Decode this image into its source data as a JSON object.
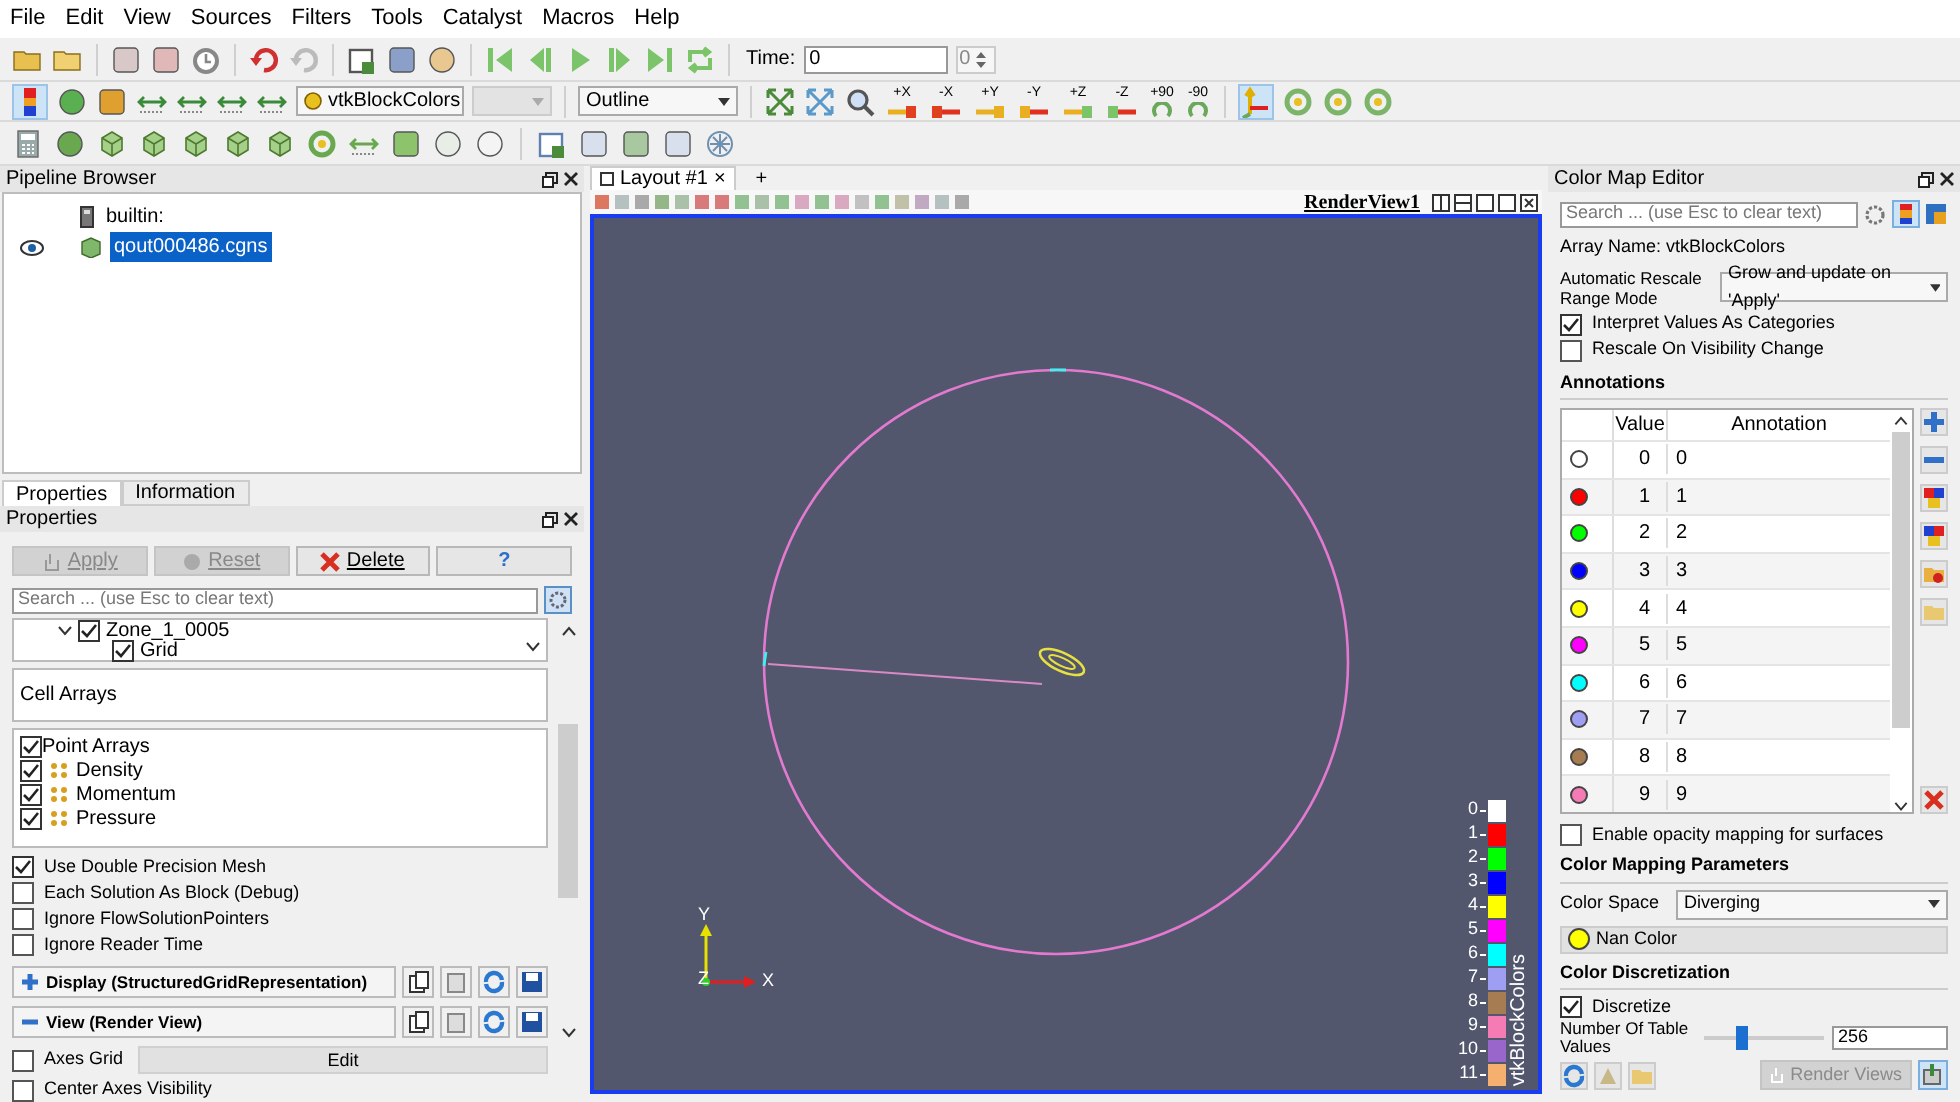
{
  "menu": [
    "File",
    "Edit",
    "View",
    "Sources",
    "Filters",
    "Tools",
    "Catalyst",
    "Macros",
    "Help"
  ],
  "time": {
    "label": "Time:",
    "value": "0",
    "step": "0"
  },
  "representation_toolbar": {
    "array": "vtkBlockColors",
    "representation": "Outline"
  },
  "camera_buttons": [
    {
      "label": "+X"
    },
    {
      "label": "-X"
    },
    {
      "label": "+Y"
    },
    {
      "label": "-Y"
    },
    {
      "label": "+Z"
    },
    {
      "label": "-Z"
    },
    {
      "label": "+90"
    },
    {
      "label": "-90"
    }
  ],
  "pipeline_browser": {
    "title": "Pipeline Browser",
    "items": [
      {
        "label": "builtin:",
        "selected": false,
        "visible": false
      },
      {
        "label": "qout000486.cgns",
        "selected": true,
        "visible": true
      }
    ]
  },
  "panel_tabs": [
    {
      "label": "Properties",
      "selected": true
    },
    {
      "label": "Information",
      "selected": false
    }
  ],
  "properties": {
    "title": "Properties",
    "buttons": [
      {
        "label": "Apply",
        "kind": "apply",
        "disabled": true
      },
      {
        "label": "Reset",
        "kind": "reset",
        "disabled": true
      },
      {
        "label": "Delete",
        "kind": "delete",
        "disabled": false
      },
      {
        "label": "?",
        "kind": "help",
        "disabled": false
      }
    ],
    "search_placeholder": "Search ... (use Esc to clear text)",
    "tree": [
      {
        "label": "Zone_1_0005",
        "checked": true,
        "expanded": true,
        "children": [
          {
            "label": "Grid",
            "checked": true
          }
        ]
      }
    ],
    "cell_arrays": {
      "title": "Cell Arrays"
    },
    "point_arrays": {
      "title": "Point Arrays",
      "checked": true,
      "items": [
        {
          "label": "Density",
          "checked": true
        },
        {
          "label": "Momentum",
          "checked": true
        },
        {
          "label": "Pressure",
          "checked": true
        }
      ]
    },
    "options": [
      {
        "label": "Use Double Precision Mesh",
        "checked": true
      },
      {
        "label": "Each Solution As Block (Debug)",
        "checked": false
      },
      {
        "label": "Ignore FlowSolutionPointers",
        "checked": false
      },
      {
        "label": "Ignore Reader Time",
        "checked": false
      }
    ],
    "sections": [
      {
        "label": "Display (StructuredGridRepresentation)",
        "kind": "display"
      },
      {
        "label": "View (Render View)",
        "kind": "view"
      }
    ],
    "axes_grid": {
      "label": "Axes Grid",
      "checked": false,
      "button": "Edit"
    },
    "center_axes": {
      "label": "Center Axes Visibility",
      "checked": false
    }
  },
  "layout_tab": {
    "label": "Layout #1",
    "close": "×",
    "add": "+"
  },
  "view": {
    "title": "RenderView1",
    "axes": {
      "y": "Y",
      "z": "Z",
      "x": "X"
    },
    "legend": {
      "title": "vtkBlockColors",
      "entries": [
        {
          "label": "0",
          "color": "#ffffff"
        },
        {
          "label": "1",
          "color": "#ff0000"
        },
        {
          "label": "2",
          "color": "#00ff00"
        },
        {
          "label": "3",
          "color": "#0000ff"
        },
        {
          "label": "4",
          "color": "#ffff00"
        },
        {
          "label": "5",
          "color": "#ff00ff"
        },
        {
          "label": "6",
          "color": "#00ffff"
        },
        {
          "label": "7",
          "color": "#9e9ef2"
        },
        {
          "label": "8",
          "color": "#a67c52"
        },
        {
          "label": "9",
          "color": "#f47bb4"
        },
        {
          "label": "10",
          "color": "#9966cc"
        },
        {
          "label": "11",
          "color": "#f5b070"
        }
      ]
    }
  },
  "color_map_editor": {
    "title": "Color Map Editor",
    "search_placeholder": "Search ... (use Esc to clear text)",
    "array_name": "Array Name: vtkBlockColors",
    "rescale_label": "Automatic Rescale Range Mode",
    "rescale_mode": "Grow and update on 'Apply'",
    "checks": [
      {
        "label": "Interpret Values As Categories",
        "checked": true
      },
      {
        "label": "Rescale On Visibility Change",
        "checked": false
      }
    ],
    "annotations_title": "Annotations",
    "columns": [
      "Value",
      "Annotation"
    ],
    "rows": [
      {
        "value": "0",
        "annotation": "0",
        "color": "#ffffff"
      },
      {
        "value": "1",
        "annotation": "1",
        "color": "#ff0000"
      },
      {
        "value": "2",
        "annotation": "2",
        "color": "#00ff00"
      },
      {
        "value": "3",
        "annotation": "3",
        "color": "#0000ff"
      },
      {
        "value": "4",
        "annotation": "4",
        "color": "#ffff00"
      },
      {
        "value": "5",
        "annotation": "5",
        "color": "#ff00ff"
      },
      {
        "value": "6",
        "annotation": "6",
        "color": "#00ffff"
      },
      {
        "value": "7",
        "annotation": "7",
        "color": "#9e9ef2"
      },
      {
        "value": "8",
        "annotation": "8",
        "color": "#a67c52"
      },
      {
        "value": "9",
        "annotation": "9",
        "color": "#f47bb4"
      }
    ],
    "opacity_mapping": {
      "label": "Enable opacity mapping for surfaces",
      "checked": false
    },
    "mapping_title": "Color Mapping Parameters",
    "color_space_label": "Color Space",
    "color_space": "Diverging",
    "nan_color": {
      "label": "Nan Color",
      "color": "#ffff00"
    },
    "discretization_title": "Color Discretization",
    "discretize": {
      "label": "Discretize",
      "checked": true
    },
    "table_values": {
      "label": "Number Of Table Values",
      "level": 0.3,
      "value": "256"
    },
    "render_button": {
      "label": "Render Views",
      "disabled": true
    }
  }
}
